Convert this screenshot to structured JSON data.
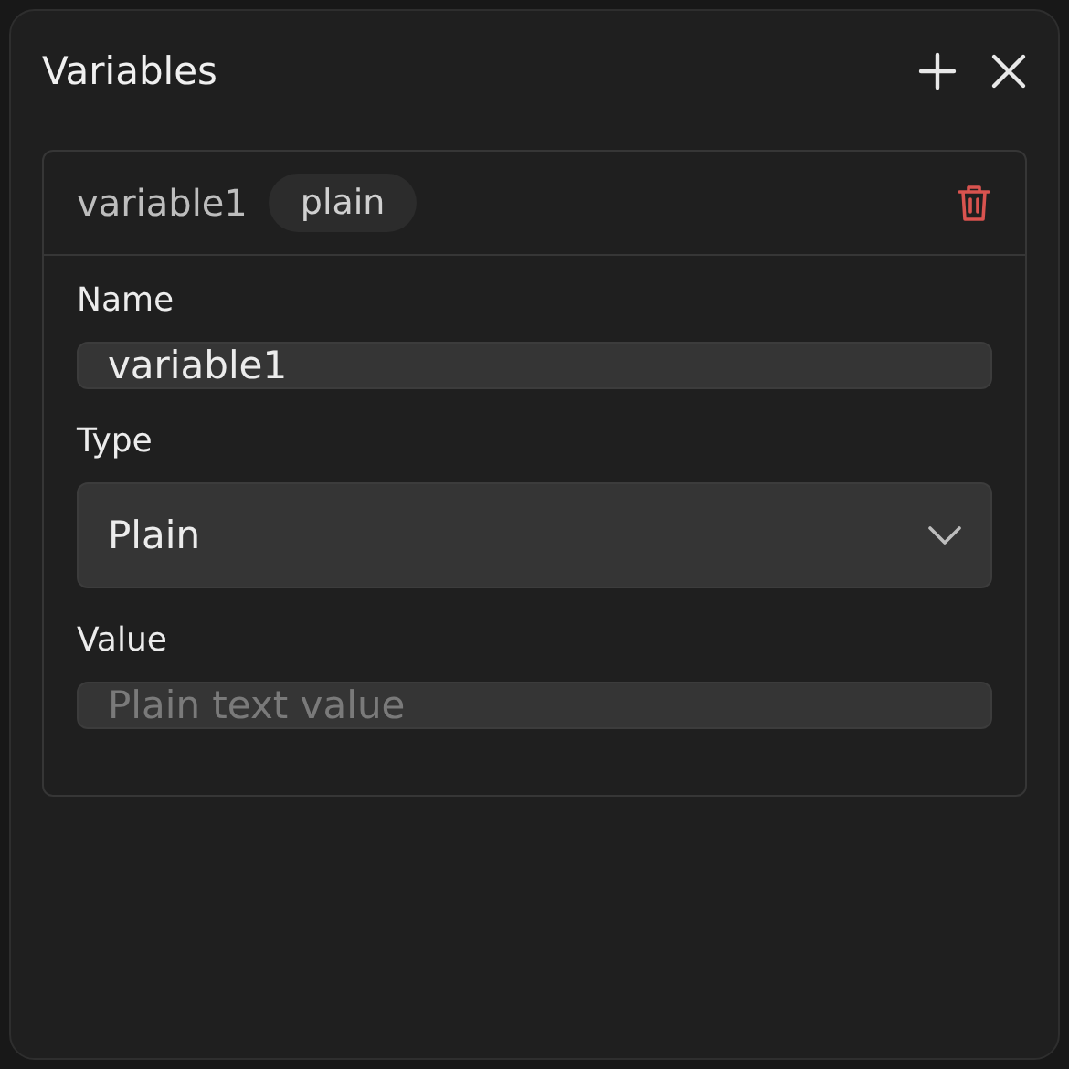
{
  "panel": {
    "title": "Variables"
  },
  "variable": {
    "name": "variable1",
    "type_badge": "plain",
    "fields": [
      {
        "kind": "text",
        "label": "Name",
        "value": "variable1"
      },
      {
        "kind": "select",
        "label": "Type",
        "value": "Plain"
      },
      {
        "kind": "text",
        "label": "Value",
        "placeholder": "Plain text value"
      }
    ]
  }
}
